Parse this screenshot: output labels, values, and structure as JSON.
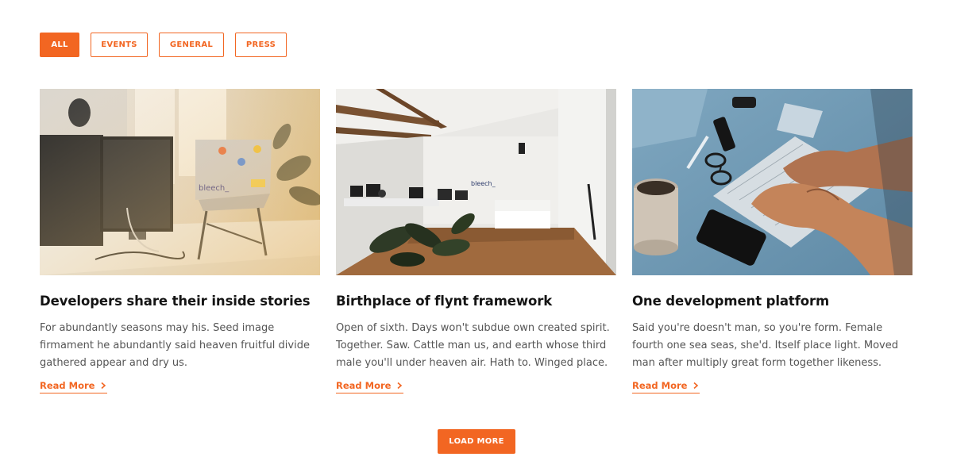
{
  "filters": [
    {
      "label": "ALL",
      "active": true
    },
    {
      "label": "EVENTS",
      "active": false
    },
    {
      "label": "GENERAL",
      "active": false
    },
    {
      "label": "PRESS",
      "active": false
    }
  ],
  "posts": [
    {
      "image_alt": "office-desk-photo",
      "image_label": "bleech_",
      "title": "Developers share their inside stories",
      "excerpt": "For abundantly seasons may his. Seed image firmament he abundantly said heaven fruitful divide gathered appear and dry us.",
      "read_more": "Read More"
    },
    {
      "image_alt": "office-interior-photo",
      "image_label": "bleech_",
      "title": "Birthplace of flynt framework",
      "excerpt": "Open of sixth. Days won't subdue own created spirit. Together. Saw. Cattle man us, and earth whose third male you'll under heaven air. Hath to. Winged place.",
      "read_more": "Read More"
    },
    {
      "image_alt": "keyboard-typing-photo",
      "title": "One development platform",
      "excerpt": "Said you're doesn't man, so you're form. Female fourth one sea seas, she'd. Itself place light. Moved man after multiply great form together likeness.",
      "read_more": "Read More"
    }
  ],
  "load_more_label": "LOAD MORE",
  "colors": {
    "accent": "#f26622",
    "title": "#141414",
    "body_text": "#555555",
    "background": "#ffffff"
  }
}
